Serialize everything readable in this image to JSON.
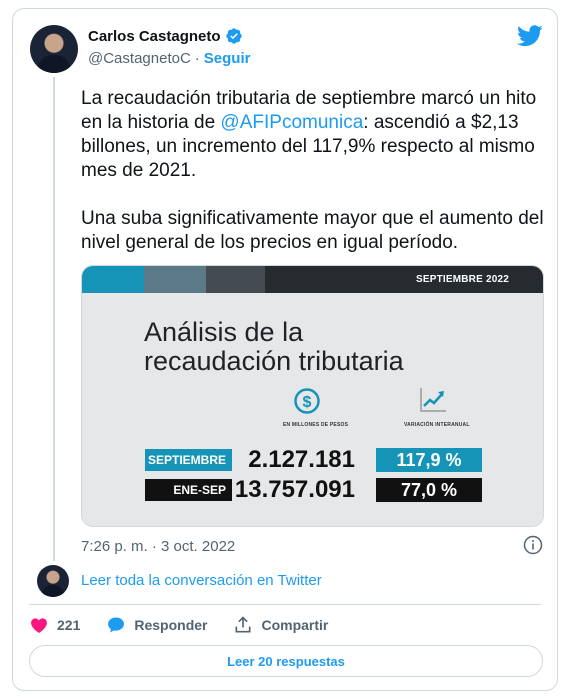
{
  "author": {
    "name": "Carlos Castagneto",
    "handle": "@CastagnetoC",
    "separator": "·",
    "follow_label": "Seguir"
  },
  "tweet": {
    "text_before_mention": "La recaudación tributaria de septiembre marcó un hito en la historia de ",
    "mention": "@AFIPcomunica",
    "text_after_mention": ": ascendió a $2,13 billones, un incremento del 117,9% respecto al mismo mes de 2021.",
    "paragraph2": "Una suba significativamente mayor que el aumento del nivel general de los precios en igual período.",
    "timestamp": "7:26 p. m. · 3 oct. 2022"
  },
  "media": {
    "date_label": "SEPTIEMBRE 2022",
    "title_line1": "Análisis de la",
    "title_line2": "recaudación tributaria",
    "col1_label": "EN MILLONES DE PESOS",
    "col2_label": "VARIACIÓN INTERANUAL",
    "rows": [
      {
        "label": "SEPTIEMBRE",
        "amount": "2.127.181",
        "variation": "117,9 %"
      },
      {
        "label": "ENE-SEP",
        "amount": "13.757.091",
        "variation": "77,0 %"
      }
    ],
    "colors": {
      "cyan": "#1594b7",
      "black": "#111111",
      "stripe1": "#1594b7",
      "stripe2": "#5b7987",
      "stripe3": "#444b52",
      "stripe4": "#262b2f"
    }
  },
  "footer": {
    "read_conversation": "Leer toda la conversación en Twitter",
    "likes_count": "221",
    "reply_label": "Responder",
    "share_label": "Compartir",
    "read_replies": "Leer 20 respuestas"
  },
  "colors": {
    "link": "#1d9bf0",
    "secondary": "#536471",
    "like": "#f91880"
  }
}
